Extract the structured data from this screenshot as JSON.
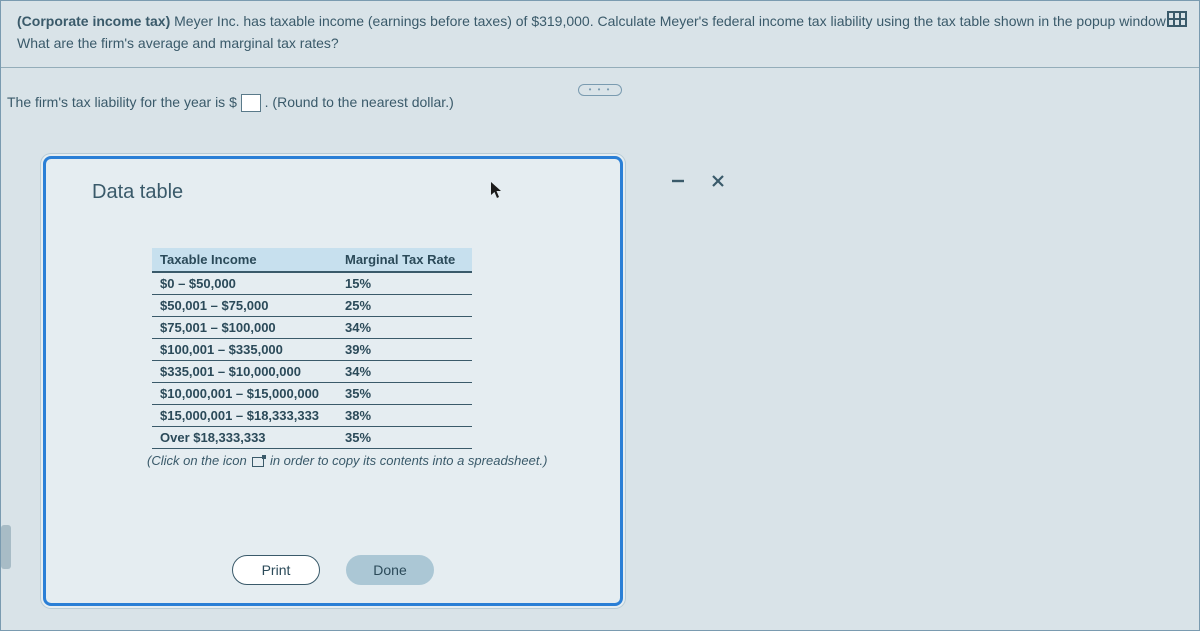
{
  "question": {
    "tag": "(Corporate income tax)",
    "body_line1": " Meyer Inc. has taxable income (earnings before taxes) of $319,000. Calculate Meyer's federal income tax liability using the tax table shown in the popup window:",
    "body_line2": "What are the firm's average and marginal tax rates?"
  },
  "collapse_label": "• • •",
  "answer": {
    "prefix": "The firm's tax liability for the year is $",
    "input_value": "",
    "suffix": ".  (Round to the nearest dollar.)"
  },
  "dialog": {
    "title": "Data table",
    "columns": [
      "Taxable Income",
      "Marginal Tax Rate"
    ],
    "rows": [
      {
        "bracket": "$0 – $50,000",
        "rate": "15%"
      },
      {
        "bracket": "$50,001 – $75,000",
        "rate": "25%"
      },
      {
        "bracket": "$75,001 – $100,000",
        "rate": "34%"
      },
      {
        "bracket": "$100,001 – $335,000",
        "rate": "39%"
      },
      {
        "bracket": "$335,001 – $10,000,000",
        "rate": "34%"
      },
      {
        "bracket": "$10,000,001 – $15,000,000",
        "rate": "35%"
      },
      {
        "bracket": "$15,000,001 – $18,333,333",
        "rate": "38%"
      },
      {
        "bracket": "Over $18,333,333",
        "rate": "35%"
      }
    ],
    "copy_note_prefix": "(Click on the icon ",
    "copy_note_suffix": " in order to copy its contents into a spreadsheet.)",
    "print_label": "Print",
    "done_label": "Done"
  }
}
